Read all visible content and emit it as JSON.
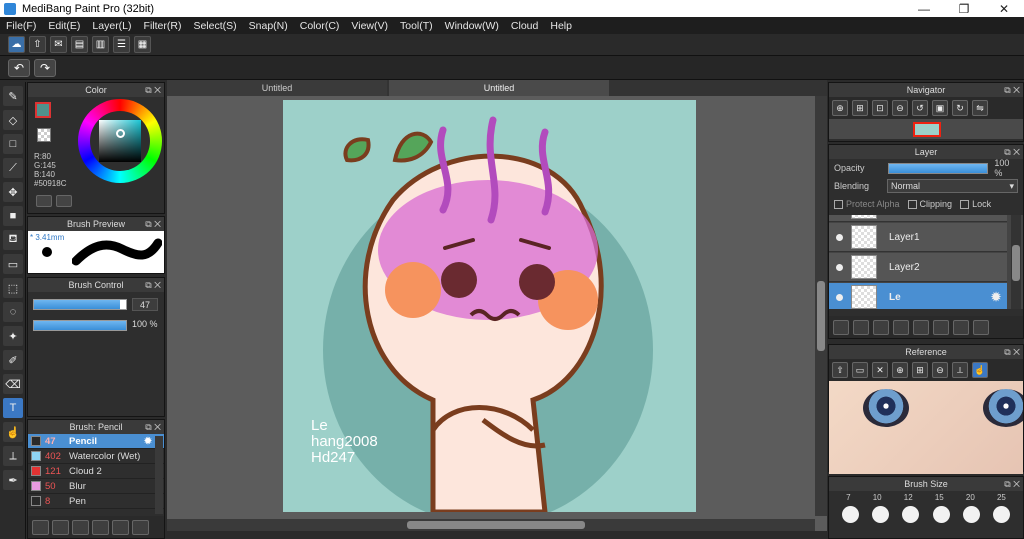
{
  "window": {
    "title": "MediBang Paint Pro (32bit)",
    "minimize": "—",
    "maximize": "❐",
    "close": "✕"
  },
  "menu": [
    "File(F)",
    "Edit(E)",
    "Layer(L)",
    "Filter(R)",
    "Select(S)",
    "Snap(N)",
    "Color(C)",
    "View(V)",
    "Tool(T)",
    "Window(W)",
    "Cloud",
    "Help"
  ],
  "color_panel": {
    "title": "Color",
    "r": "R:80",
    "g": "G:145",
    "b": "B:140",
    "hex": "#50918C",
    "fg": "#50918c"
  },
  "brush_preview": {
    "title": "Brush Preview",
    "size": "* 3.41mm"
  },
  "brush_control": {
    "title": "Brush Control",
    "size_value": "47",
    "size_fraction": 0.94,
    "opacity_value": "100 %",
    "opacity_fraction": 1.0
  },
  "brush_panel": {
    "title": "Brush: Pencil",
    "items": [
      {
        "size": "47",
        "name": "Pencil",
        "color": "#2a2a2a"
      },
      {
        "size": "402",
        "name": "Watercolor (Wet)",
        "color": "#8fd4f4"
      },
      {
        "size": "121",
        "name": "Cloud 2",
        "color": "#e33333"
      },
      {
        "size": "50",
        "name": "Blur",
        "color": "#e99be0"
      },
      {
        "size": "8",
        "name": "Pen",
        "color": "#2a2a2a"
      }
    ]
  },
  "canvas": {
    "tab1": "Untitled",
    "tab2": "Untitled",
    "art_text": "Le\nhang2008\nHd247",
    "bg": "#9dd0c9"
  },
  "navigator": {
    "title": "Navigator"
  },
  "layer_panel": {
    "title": "Layer",
    "opacity_label": "Opacity",
    "opacity_value": "100 %",
    "opacity_fraction": 1.0,
    "blending_label": "Blending",
    "blending_value": "Normal",
    "protect_alpha": "Protect Alpha",
    "clipping": "Clipping",
    "lock": "Lock",
    "layers": [
      {
        "name": "Layer1"
      },
      {
        "name": "Layer2"
      },
      {
        "name": "Le"
      }
    ]
  },
  "reference": {
    "title": "Reference"
  },
  "brush_size": {
    "title": "Brush Size",
    "sizes": [
      "7",
      "10",
      "12",
      "15",
      "20",
      "25"
    ]
  }
}
